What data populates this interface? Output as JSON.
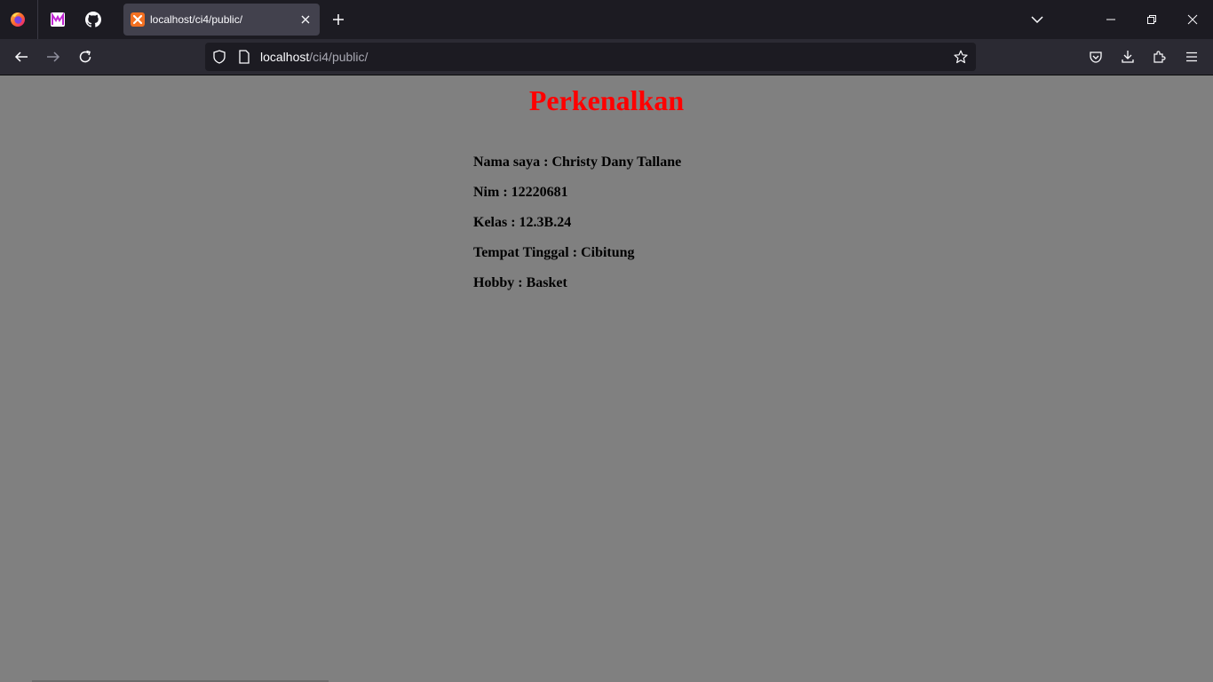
{
  "browser": {
    "pinned_tabs": [
      {
        "name": "firefox-view-icon"
      },
      {
        "name": "pinned-tab-m-icon"
      },
      {
        "name": "github-icon"
      }
    ],
    "active_tab": {
      "title": "localhost/ci4/public/",
      "favicon": "xampp-icon"
    },
    "url": {
      "host": "localhost",
      "path": "/ci4/public/"
    },
    "colors": {
      "tabstrip_bg": "#1c1b22",
      "navbar_bg": "#2b2a33",
      "active_tab_bg": "#42414d",
      "urlbar_bg": "#1c1b22"
    }
  },
  "page": {
    "background": "#808080",
    "heading": "Perkenalkan",
    "heading_color": "#ff0000",
    "info": [
      "Nama saya : Christy Dany Tallane",
      "Nim : 12220681",
      "Kelas : 12.3B.24",
      "Tempat Tinggal : Cibitung",
      "Hobby : Basket"
    ]
  }
}
